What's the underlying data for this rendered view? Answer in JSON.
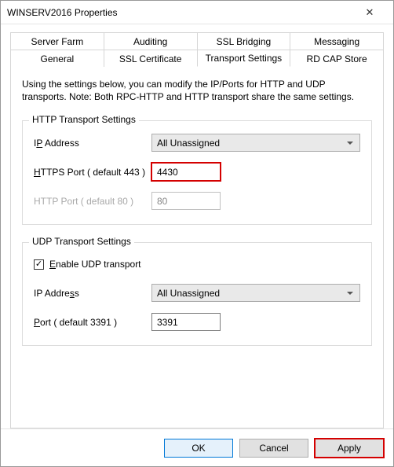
{
  "window": {
    "title": "WINSERV2016 Properties"
  },
  "tabs": {
    "row1": [
      "Server Farm",
      "Auditing",
      "SSL Bridging",
      "Messaging"
    ],
    "row2": [
      "General",
      "SSL Certificate",
      "Transport Settings",
      "RD CAP Store"
    ],
    "active": "Transport Settings"
  },
  "intro": "Using the settings below, you can modify the IP/Ports for HTTP and UDP transports. Note: Both RPC-HTTP and HTTP transport share the same settings.",
  "http_group": {
    "title": "HTTP Transport Settings",
    "ip_label_pre": "I",
    "ip_label_ul": "P",
    "ip_label_post": " Address",
    "ip_value": "All Unassigned",
    "https_label_ul": "H",
    "https_label_post": "TTPS Port ( default 443 )",
    "https_value": "4430",
    "http_label": "HTTP Port ( default 80 )",
    "http_value": "80"
  },
  "udp_group": {
    "title": "UDP Transport Settings",
    "enable_label_ul": "E",
    "enable_label_post": "nable UDP transport",
    "enable_checked": true,
    "ip_label_pre": "IP Addre",
    "ip_label_ul": "s",
    "ip_label_post": "s",
    "ip_value": "All Unassigned",
    "port_label_ul": "P",
    "port_label_post": "ort ( default 3391 )",
    "port_value": "3391"
  },
  "buttons": {
    "ok": "OK",
    "cancel": "Cancel",
    "apply": "Apply"
  }
}
